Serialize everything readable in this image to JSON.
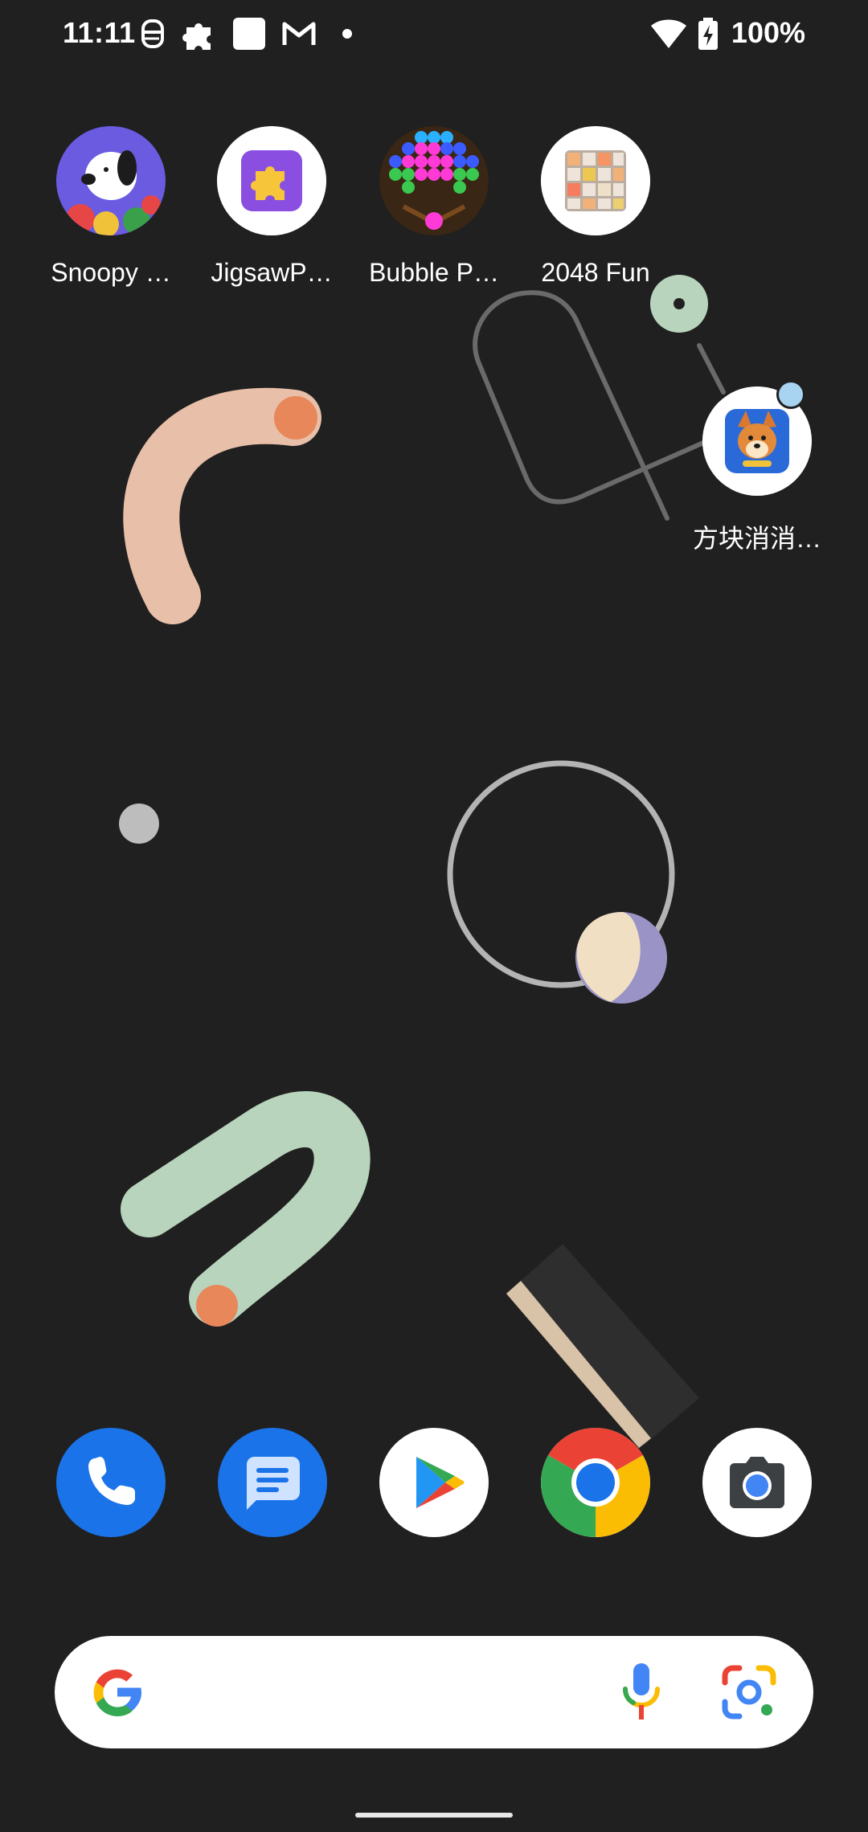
{
  "status_bar": {
    "time": "11:11",
    "battery_percent": "100%",
    "icons": [
      "face-icon",
      "puzzle-icon",
      "square-app-icon",
      "gmail-icon",
      "dot-icon",
      "wifi-icon",
      "battery-charging-icon"
    ]
  },
  "home_apps": [
    {
      "label": "Snoopy …",
      "icon": "snoopy-icon"
    },
    {
      "label": "JigsawP…",
      "icon": "jigsaw-icon"
    },
    {
      "label": "Bubble P…",
      "icon": "bubble-pop-icon"
    },
    {
      "label": "2048 Fun",
      "icon": "2048-icon"
    },
    {
      "label": "方块消消…",
      "icon": "dog-game-icon",
      "has_notification": true
    }
  ],
  "dock": [
    {
      "name": "Phone",
      "icon": "phone-icon"
    },
    {
      "name": "Messages",
      "icon": "messages-icon"
    },
    {
      "name": "Play Store",
      "icon": "play-store-icon"
    },
    {
      "name": "Chrome",
      "icon": "chrome-icon"
    },
    {
      "name": "Camera",
      "icon": "camera-icon"
    }
  ],
  "search_bar": {
    "icons": [
      "google-g-icon",
      "microphone-icon",
      "lens-icon"
    ]
  },
  "colors": {
    "background": "#202020",
    "peach": "#e8bfa8",
    "orange": "#e8875a",
    "sage": "#b8d4bc",
    "lavender": "#9a93c6",
    "cream": "#f0dfc2",
    "ring": "#b4b4b4",
    "blue_dock": "#1a73e8"
  }
}
